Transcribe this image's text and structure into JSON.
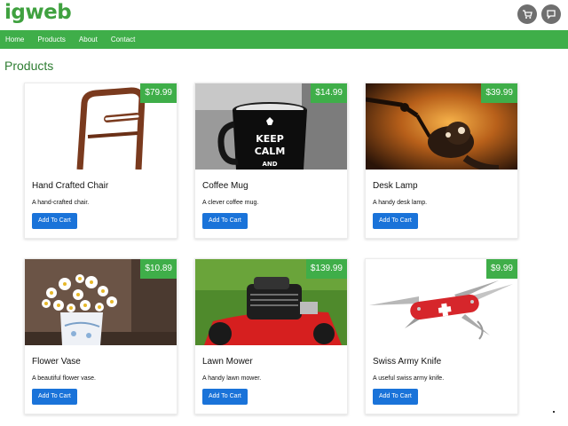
{
  "brand": {
    "name": "igweb",
    "accent": "#3fae49",
    "button_color": "#1a73d9"
  },
  "header_icons": [
    {
      "name": "cart-icon"
    },
    {
      "name": "chat-icon"
    }
  ],
  "nav": {
    "items": [
      {
        "label": "Home"
      },
      {
        "label": "Products"
      },
      {
        "label": "About"
      },
      {
        "label": "Contact"
      }
    ]
  },
  "page": {
    "heading": "Products"
  },
  "products": [
    {
      "name": "Hand Crafted Chair",
      "price": "$79.99",
      "description": "A hand-crafted chair.",
      "button": "Add To Cart"
    },
    {
      "name": "Coffee Mug",
      "price": "$14.99",
      "description": "A clever coffee mug.",
      "button": "Add To Cart"
    },
    {
      "name": "Desk Lamp",
      "price": "$39.99",
      "description": "A handy desk lamp.",
      "button": "Add To Cart"
    },
    {
      "name": "Flower Vase",
      "price": "$10.89",
      "description": "A beautiful flower vase.",
      "button": "Add To Cart"
    },
    {
      "name": "Lawn Mower",
      "price": "$139.99",
      "description": "A handy lawn mower.",
      "button": "Add To Cart"
    },
    {
      "name": "Swiss Army Knife",
      "price": "$9.99",
      "description": "A useful swiss army knife.",
      "button": "Add To Cart"
    }
  ],
  "mug_print": {
    "line1": "KEEP",
    "line2": "CALM",
    "line3": "AND"
  }
}
